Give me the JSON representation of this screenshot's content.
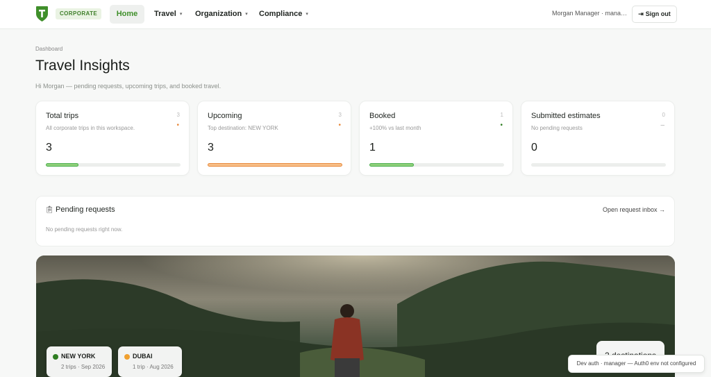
{
  "header": {
    "badge": "CORPORATE",
    "nav": {
      "home": "Home",
      "travel": "Travel",
      "organization": "Organization",
      "compliance": "Compliance"
    },
    "user": "Morgan Manager · mana…",
    "sign_out": "Sign out",
    "accent_color": "#3f8f2a"
  },
  "page": {
    "breadcrumb": "Dashboard",
    "title": "Travel Insights",
    "subtitle": "Hi Morgan — pending requests, upcoming trips, and booked travel."
  },
  "stats": [
    {
      "label": "Total trips",
      "corner": "3",
      "description": "All corporate trips in this workspace.",
      "value": "3",
      "indicator": "•",
      "indicator_color": "#e8883a",
      "progress": 0.24,
      "bar_color": "#8fd07a"
    },
    {
      "label": "Upcoming",
      "corner": "3",
      "description": "Top destination: NEW YORK",
      "value": "3",
      "indicator": "•",
      "indicator_color": "#e8883a",
      "progress": 1.0,
      "bar_color": "#f7c08a"
    },
    {
      "label": "Booked",
      "corner": "1",
      "description": "+100% vs last month",
      "value": "1",
      "indicator": "•",
      "indicator_color": "#2e7d22",
      "progress": 0.33,
      "bar_color": "#8fd07a"
    },
    {
      "label": "Submitted estimates",
      "corner": "0",
      "description": "No pending requests",
      "value": "0",
      "indicator": "–",
      "indicator_color": "#aaaaaa",
      "progress": 0.0,
      "bar_color": "#8fd07a"
    }
  ],
  "pending": {
    "title": "Pending requests",
    "link": "Open request inbox →",
    "empty": "No pending requests right now."
  },
  "hero": {
    "destinations": [
      {
        "name": "NEW YORK",
        "meta": "2 trips · Sep 2026",
        "dot_color": "#2e7d22"
      },
      {
        "name": "DUBAI",
        "meta": "1 trip · Aug 2026",
        "dot_color": "#f0a030"
      }
    ],
    "summary": "2 destinations"
  },
  "toast": "Dev auth · manager — Auth0 env not configured"
}
